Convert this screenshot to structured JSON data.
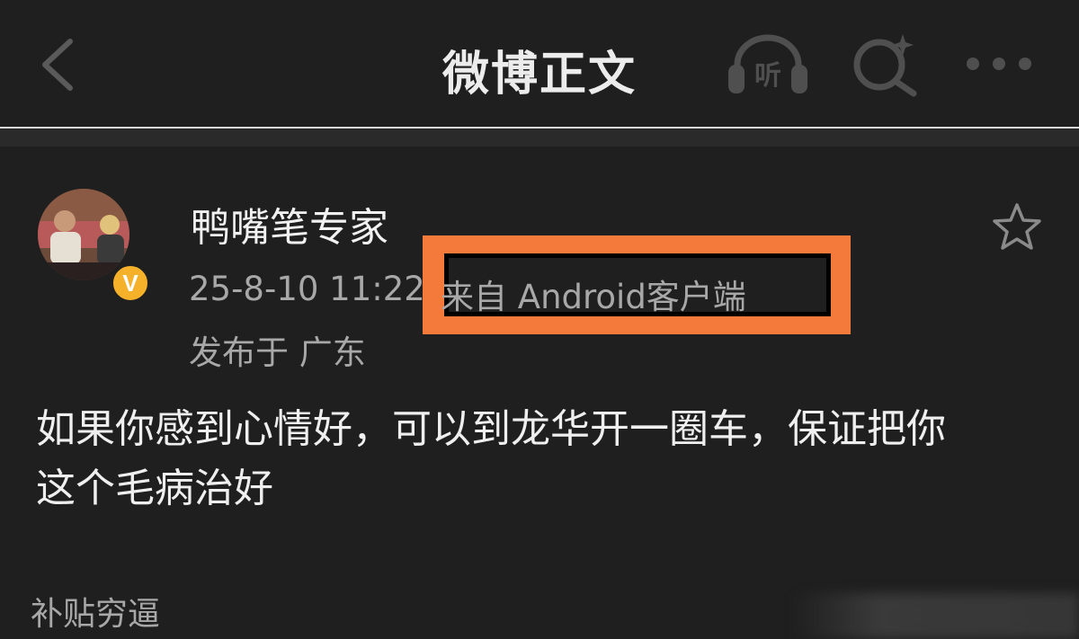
{
  "header": {
    "title": "微博正文",
    "listen_label": "听"
  },
  "post": {
    "author_name": "鸭嘴笔专家",
    "verified_badge": "V",
    "timestamp": "25-8-10 11:22",
    "source": "来自 Android客户端",
    "location": "发布于 广东",
    "content_line1": "如果你感到心情好，可以到龙华开一圈车，保证把你",
    "content_line2": "这个毛病治好",
    "topic_tag": "补贴穷逼"
  },
  "colors": {
    "background": "#1f1f1f",
    "highlight": "#f47a3c",
    "verified": "#f6b12b",
    "secondary_text": "#a8a8a8"
  },
  "icons": {
    "back": "chevron-left-icon",
    "listen": "headphones-icon",
    "search": "search-sparkle-icon",
    "more": "more-dots-icon",
    "favorite": "star-icon"
  }
}
